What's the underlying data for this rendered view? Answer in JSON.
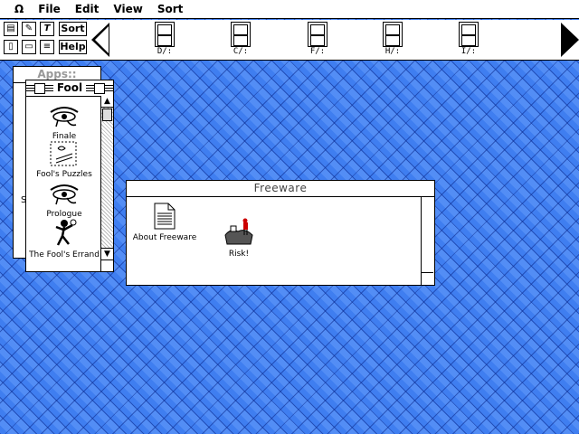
{
  "menubar": {
    "apple": "Ω",
    "items": [
      "File",
      "Edit",
      "View",
      "Sort"
    ]
  },
  "toolbar": {
    "sort_label": "Sort",
    "help_label": "Help",
    "drives": [
      "D/:",
      "C/:",
      "F/:",
      "H/:",
      "I/:"
    ]
  },
  "apps_window": {
    "title": "Apps::",
    "partial_text": "S"
  },
  "fool_window": {
    "title": "Fool",
    "items": [
      "Finale",
      "Fool's Puzzles",
      "Prologue",
      "The Fool's Errand"
    ]
  },
  "freeware_window": {
    "title": "Freeware",
    "items": [
      "About Freeware",
      "Risk!"
    ]
  },
  "colors": {
    "desktop": "#3f7ef0",
    "pattern": "#0a288c"
  }
}
